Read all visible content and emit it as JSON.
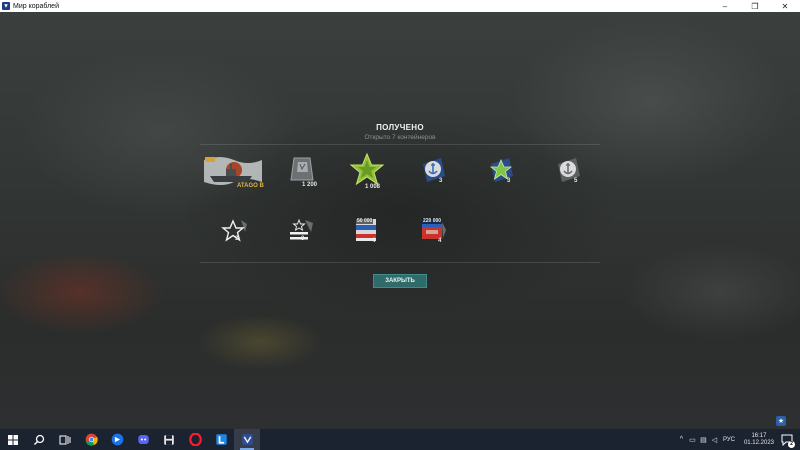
{
  "window": {
    "title": "Мир кораблей",
    "minimize": "–",
    "maximize": "❐",
    "close": "✕"
  },
  "dialog": {
    "title": "ПОЛУЧЕНО",
    "subtitle": "Открыто 7 контейнеров",
    "close_label": "ЗАКРЫТЬ",
    "rewards": [
      {
        "name": "ship-atago",
        "label": "ATAGO B"
      },
      {
        "name": "signal-flags",
        "label": "1 200"
      },
      {
        "name": "free-xp-star",
        "label": "1 008"
      },
      {
        "name": "anchor-camo",
        "label": "3"
      },
      {
        "name": "blue-star-camo",
        "label": "3"
      },
      {
        "name": "anchor-camo-2",
        "label": "5"
      },
      {
        "name": "star-outline",
        "label": "3"
      },
      {
        "name": "stripes-star",
        "label": "3"
      },
      {
        "name": "flag-50000",
        "label": "4",
        "badge": "50 000"
      },
      {
        "name": "flag-220000",
        "label": "4",
        "badge": "220 000"
      }
    ]
  },
  "taskbar": {
    "apps": [
      "start",
      "search",
      "task-view",
      "chrome",
      "photos",
      "discord",
      "save",
      "opera",
      "launcher",
      "world-of-warships"
    ],
    "tray": {
      "language": "РУС",
      "time": "16:17",
      "date": "01.12.2023",
      "notifications": "2"
    }
  },
  "colors": {
    "accent_button": "#2e6b6a",
    "gold_text": "#e0b84a",
    "taskbar": "#1b2230"
  }
}
